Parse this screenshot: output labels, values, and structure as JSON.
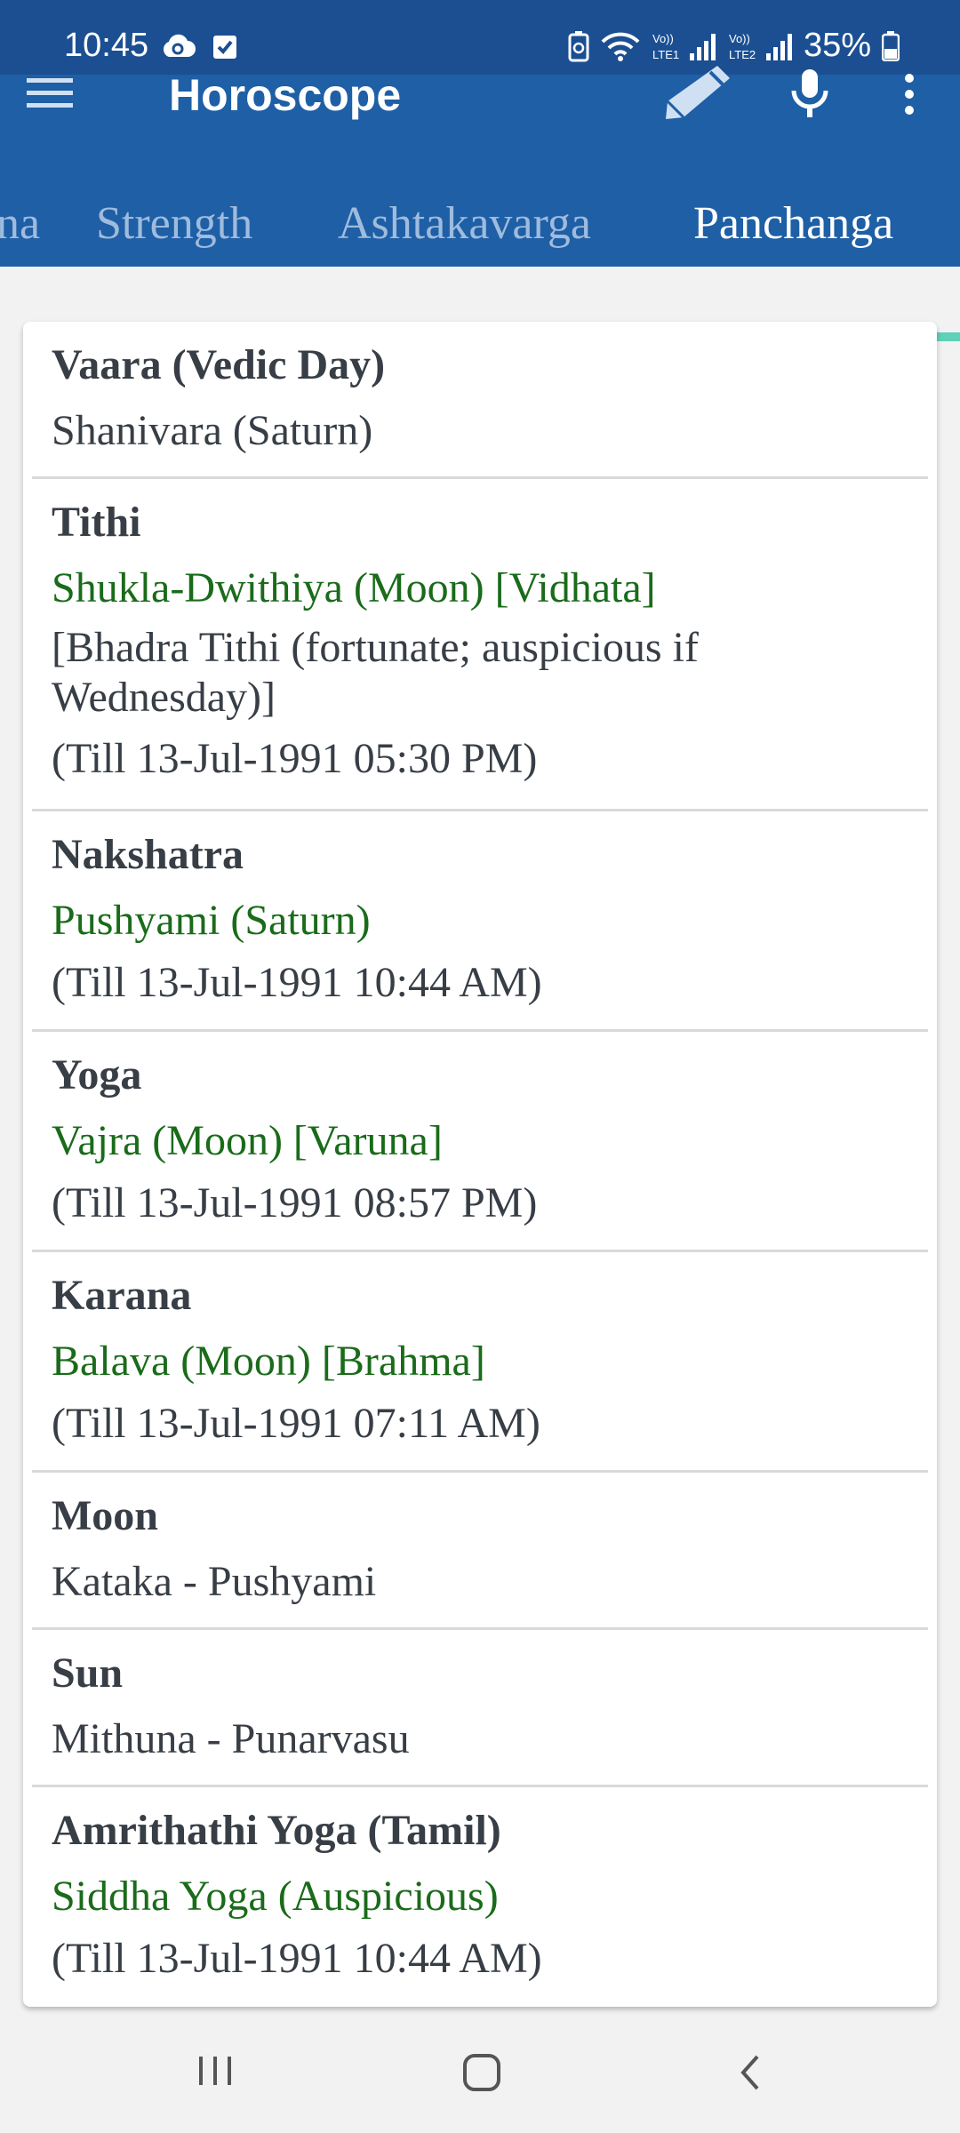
{
  "status_bar": {
    "time": "10:45",
    "battery": "35%",
    "icons": [
      "cloud-sync-icon",
      "check-box-icon",
      "battery-saver-icon",
      "wifi-icon",
      "signal-lte1-icon",
      "signal-lte2-icon",
      "battery-icon"
    ]
  },
  "app_bar": {
    "title": "Horoscope",
    "colors": {
      "status": "#1b4f92",
      "toolbar": "#1e5fa6",
      "indicator": "#5fd1b8"
    }
  },
  "tabs": [
    {
      "label": "na"
    },
    {
      "label": "Strength"
    },
    {
      "label": "Ashtakavarga"
    },
    {
      "label": "Panchanga",
      "active": true
    }
  ],
  "panchanga": [
    {
      "title": "Vaara (Vedic Day)",
      "value": "Shanivara (Saturn)",
      "value_color": "dark"
    },
    {
      "title": "Tithi",
      "value": "Shukla-Dwithiya (Moon) [Vidhata]",
      "value_color": "green",
      "note": "[Bhadra Tithi (fortunate; auspicious if Wednesday)]",
      "till": "(Till 13-Jul-1991 05:30 PM)"
    },
    {
      "title": "Nakshatra",
      "value": "Pushyami (Saturn)",
      "value_color": "green",
      "till": "(Till 13-Jul-1991 10:44 AM)"
    },
    {
      "title": "Yoga",
      "value": "Vajra (Moon) [Varuna]",
      "value_color": "green",
      "till": "(Till 13-Jul-1991 08:57 PM)"
    },
    {
      "title": "Karana",
      "value": "Balava (Moon) [Brahma]",
      "value_color": "green",
      "till": "(Till 13-Jul-1991 07:11 AM)"
    },
    {
      "title": "Moon",
      "value": "Kataka - Pushyami",
      "value_color": "dark"
    },
    {
      "title": "Sun",
      "value": "Mithuna - Punarvasu",
      "value_color": "dark"
    },
    {
      "title": "Amrithathi Yoga (Tamil)",
      "value": "Siddha Yoga (Auspicious)",
      "value_color": "green",
      "till": "(Till 13-Jul-1991 10:44 AM)"
    }
  ],
  "nav_bar": {
    "icons": [
      "recent-apps-icon",
      "home-icon",
      "back-icon"
    ]
  }
}
